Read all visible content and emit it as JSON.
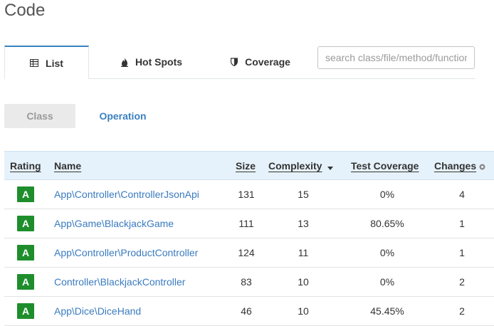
{
  "page": {
    "title": "Code"
  },
  "tabs": [
    {
      "label": "List",
      "icon": "table-icon",
      "active": true
    },
    {
      "label": "Hot Spots",
      "icon": "fire-icon",
      "active": false
    },
    {
      "label": "Coverage",
      "icon": "shield-icon",
      "active": false
    }
  ],
  "search": {
    "placeholder": "search class/file/method/function"
  },
  "subtabs": [
    {
      "label": "Class",
      "active": true
    },
    {
      "label": "Operation",
      "active": false
    }
  ],
  "table": {
    "headers": {
      "rating": "Rating",
      "name": "Name",
      "size": "Size",
      "complexity": "Complexity",
      "coverage": "Test Coverage",
      "changes": "Changes"
    },
    "sort": {
      "column": "complexity",
      "direction": "desc"
    },
    "rows": [
      {
        "rating": "A",
        "name": "App\\Controller\\ControllerJsonApi",
        "size": "131",
        "complexity": "15",
        "coverage": "0%",
        "changes": "4"
      },
      {
        "rating": "A",
        "name": "App\\Game\\BlackjackGame",
        "size": "111",
        "complexity": "13",
        "coverage": "80.65%",
        "changes": "1"
      },
      {
        "rating": "A",
        "name": "App\\Controller\\ProductController",
        "size": "124",
        "complexity": "11",
        "coverage": "0%",
        "changes": "1"
      },
      {
        "rating": "A",
        "name": "Controller\\BlackjackController",
        "size": "83",
        "complexity": "10",
        "coverage": "0%",
        "changes": "2"
      },
      {
        "rating": "A",
        "name": "App\\Dice\\DiceHand",
        "size": "46",
        "complexity": "10",
        "coverage": "45.45%",
        "changes": "2"
      }
    ]
  },
  "colors": {
    "accent": "#3a81c0",
    "rating_a": "#1e8e2c",
    "header_bg": "#e6f2fb"
  }
}
